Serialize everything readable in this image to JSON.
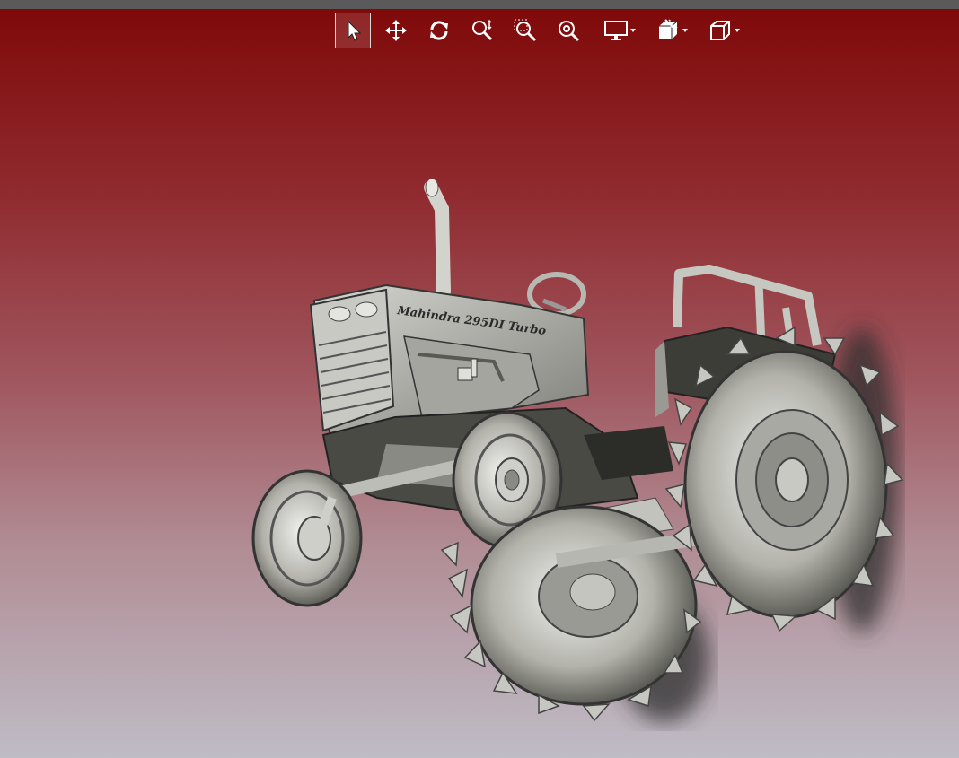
{
  "window": {
    "topbar_color": "#5a5a5a",
    "background_top": "#7f0808",
    "background_bottom": "#bfbcc6"
  },
  "toolbar": {
    "buttons": [
      {
        "name": "select-tool",
        "icon": "pointer-arrow-icon",
        "active": true
      },
      {
        "name": "pan-tool",
        "icon": "move-arrows-icon",
        "active": false
      },
      {
        "name": "rotate-tool",
        "icon": "rotate-icon",
        "active": false
      },
      {
        "name": "zoom-tool",
        "icon": "zoom-in-out-icon",
        "active": false
      },
      {
        "name": "zoom-window-tool",
        "icon": "zoom-window-icon",
        "active": false
      },
      {
        "name": "zoom-fit-tool",
        "icon": "zoom-fit-icon",
        "active": false
      },
      {
        "name": "display-mode-dropdown",
        "icon": "monitor-icon",
        "active": false
      },
      {
        "name": "section-view-dropdown",
        "icon": "section-cube-icon",
        "active": false
      },
      {
        "name": "view-orientation-dropdown",
        "icon": "cube-icon",
        "active": false
      }
    ]
  },
  "model": {
    "hood_text": "Mahindra 295DI Turbo",
    "body_color": "#b9b9b3",
    "shadow_color": "#2f2f2f"
  }
}
